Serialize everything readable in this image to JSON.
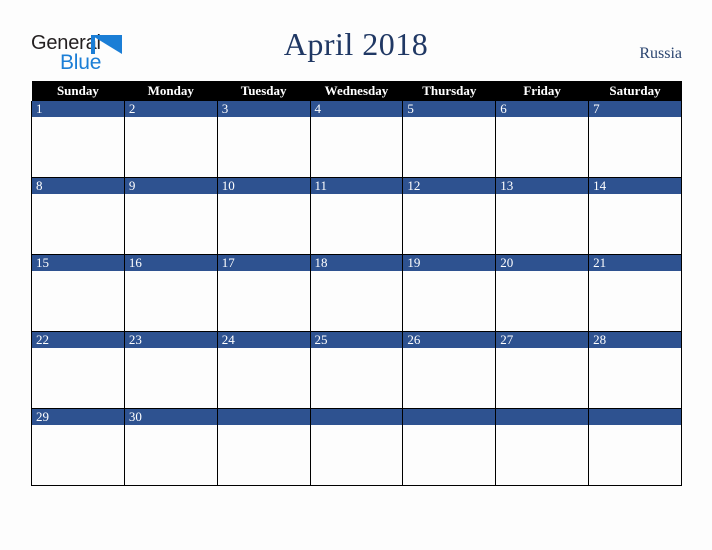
{
  "brand": {
    "name_part1": "General",
    "name_part2": "Blue",
    "triangle_color": "#1b7ed6",
    "text_color": "#231f20"
  },
  "header": {
    "title": "April 2018",
    "country": "Russia",
    "title_color": "#203864"
  },
  "colors": {
    "header_row_bg": "#000000",
    "header_row_text": "#ffffff",
    "day_band_bg": "#2e5290",
    "day_band_text": "#ffffff",
    "cell_bg": "#fdfdfd",
    "grid_line": "#000000",
    "page_bg": "#fdfdfd"
  },
  "calendar": {
    "weekday_headers": [
      "Sunday",
      "Monday",
      "Tuesday",
      "Wednesday",
      "Thursday",
      "Friday",
      "Saturday"
    ],
    "weeks": [
      {
        "days": [
          {
            "num": "1",
            "blank": false
          },
          {
            "num": "2",
            "blank": false
          },
          {
            "num": "3",
            "blank": false
          },
          {
            "num": "4",
            "blank": false
          },
          {
            "num": "5",
            "blank": false
          },
          {
            "num": "6",
            "blank": false
          },
          {
            "num": "7",
            "blank": false
          }
        ]
      },
      {
        "days": [
          {
            "num": "8",
            "blank": false
          },
          {
            "num": "9",
            "blank": false
          },
          {
            "num": "10",
            "blank": false
          },
          {
            "num": "11",
            "blank": false
          },
          {
            "num": "12",
            "blank": false
          },
          {
            "num": "13",
            "blank": false
          },
          {
            "num": "14",
            "blank": false
          }
        ]
      },
      {
        "days": [
          {
            "num": "15",
            "blank": false
          },
          {
            "num": "16",
            "blank": false
          },
          {
            "num": "17",
            "blank": false
          },
          {
            "num": "18",
            "blank": false
          },
          {
            "num": "19",
            "blank": false
          },
          {
            "num": "20",
            "blank": false
          },
          {
            "num": "21",
            "blank": false
          }
        ]
      },
      {
        "days": [
          {
            "num": "22",
            "blank": false
          },
          {
            "num": "23",
            "blank": false
          },
          {
            "num": "24",
            "blank": false
          },
          {
            "num": "25",
            "blank": false
          },
          {
            "num": "26",
            "blank": false
          },
          {
            "num": "27",
            "blank": false
          },
          {
            "num": "28",
            "blank": false
          }
        ]
      },
      {
        "days": [
          {
            "num": "29",
            "blank": false
          },
          {
            "num": "30",
            "blank": false
          },
          {
            "num": "",
            "blank": true
          },
          {
            "num": "",
            "blank": true
          },
          {
            "num": "",
            "blank": true
          },
          {
            "num": "",
            "blank": true
          },
          {
            "num": "",
            "blank": true
          }
        ]
      }
    ]
  }
}
